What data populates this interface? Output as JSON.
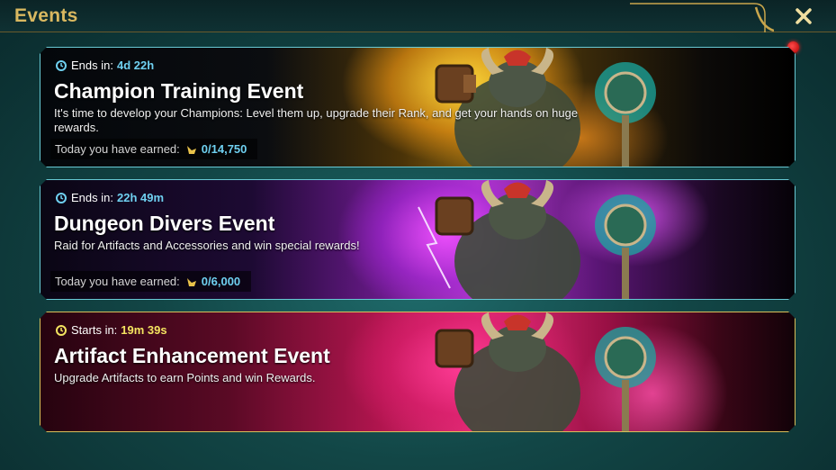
{
  "header": {
    "title": "Events",
    "close_icon": "close-x-icon",
    "accent_color": "#d9b860"
  },
  "events": [
    {
      "timer_label": "Ends in:",
      "timer_value": "4d 22h",
      "title": "Champion Training Event",
      "description": "It's time to develop your Champions: Level them up, upgrade their Rank, and get your hands on huge rewards.",
      "earned_label": "Today you have earned:",
      "earned_value": "0/14,750",
      "theme_color": "#f0b020",
      "has_notification": true
    },
    {
      "timer_label": "Ends in:",
      "timer_value": "22h 49m",
      "title": "Dungeon Divers Event",
      "description": "Raid for Artifacts and Accessories and win special rewards!",
      "earned_label": "Today you have earned:",
      "earned_value": "0/6,000",
      "theme_color": "#b03ac8"
    },
    {
      "timer_label": "Starts in:",
      "timer_value": "19m 39s",
      "title": "Artifact Enhancement Event",
      "description": "Upgrade Artifacts to earn Points and win Rewards.",
      "theme_color": "#e8307a"
    }
  ]
}
